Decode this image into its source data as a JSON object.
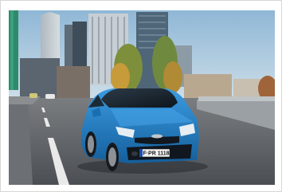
{
  "photo": {
    "subject": "car-photo",
    "license_plate": "F·PR 1118"
  },
  "colors": {
    "sky_top": "#8fb7d6",
    "sky_bottom": "#cfe0ea",
    "car_body": "#1f7fc8",
    "road": "#5d6166",
    "road_marking": "#e9e9e9"
  }
}
